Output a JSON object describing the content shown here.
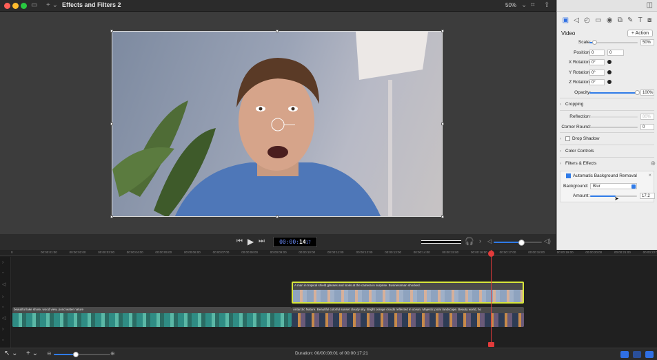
{
  "window": {
    "title": "Effects and Filters 2",
    "zoom": "50%"
  },
  "transport": {
    "timecode_prefix": "00:00:",
    "timecode_value": "14",
    "timecode_frames": "17"
  },
  "inspector": {
    "section": "Video",
    "action_button": "+ Action",
    "scale": {
      "label": "Scale:",
      "value": "50%",
      "fraction": 0.12
    },
    "position": {
      "label": "Position:",
      "x": "0",
      "y": "0"
    },
    "x_rotation": {
      "label": "X Rotation:",
      "value": "0°"
    },
    "y_rotation": {
      "label": "Y Rotation:",
      "value": "0°"
    },
    "z_rotation": {
      "label": "Z Rotation:",
      "value": "0°"
    },
    "opacity": {
      "label": "Opacity:",
      "value": "100%",
      "fraction": 1.0
    },
    "cropping": "Cropping",
    "reflection": {
      "label": "Reflection:",
      "value": "80%"
    },
    "corner_round": {
      "label": "Corner Round:",
      "value": "0"
    },
    "drop_shadow": "Drop Shadow",
    "color_controls": "Color Controls",
    "filters_effects": "Filters & Effects",
    "effect": {
      "name": "Automatic Background Removal",
      "background_label": "Background:",
      "background_value": "Blur",
      "amount_label": "Amount:",
      "amount_value": "17.2",
      "amount_fraction": 0.55
    }
  },
  "timeline": {
    "ruler_start": "0",
    "ticks": [
      "00:00:01:00",
      "00:00:02:00",
      "00:00:03:00",
      "00:00:04:00",
      "00:00:05:00",
      "00:00:06:00",
      "00:00:07:00",
      "00:00:08:00",
      "00:00:09:00",
      "00:00:10:00",
      "00:00:11:00",
      "00:00:12:00",
      "00:00:13:00",
      "00:00:14:00",
      "00:00:15:00",
      "00:00:16:00",
      "00:00:17:00",
      "00:00:18:00",
      "00:00:19:00",
      "00:00:20:00",
      "00:00:21:00",
      "00:00:22:00"
    ],
    "clip_top": "A man in tropical shield glasses and looks at the camera in surprise. Businessman shocked.",
    "clip_bottom_left": "beautiful lake shore, wood view, pond water nature",
    "clip_bottom_right": "Antarctic Nature. Beautiful colorful sunset cloudy sky. Bright orange clouds reflected in ocean. Majestic polar landscape. Beauty world, ho"
  },
  "bottombar": {
    "duration": "Duration: 00/00:08:01 of 00:00:17:21"
  },
  "colors": {
    "accent": "#2f7be8",
    "playhead": "#e23b3b",
    "selection": "#d7e53a"
  }
}
